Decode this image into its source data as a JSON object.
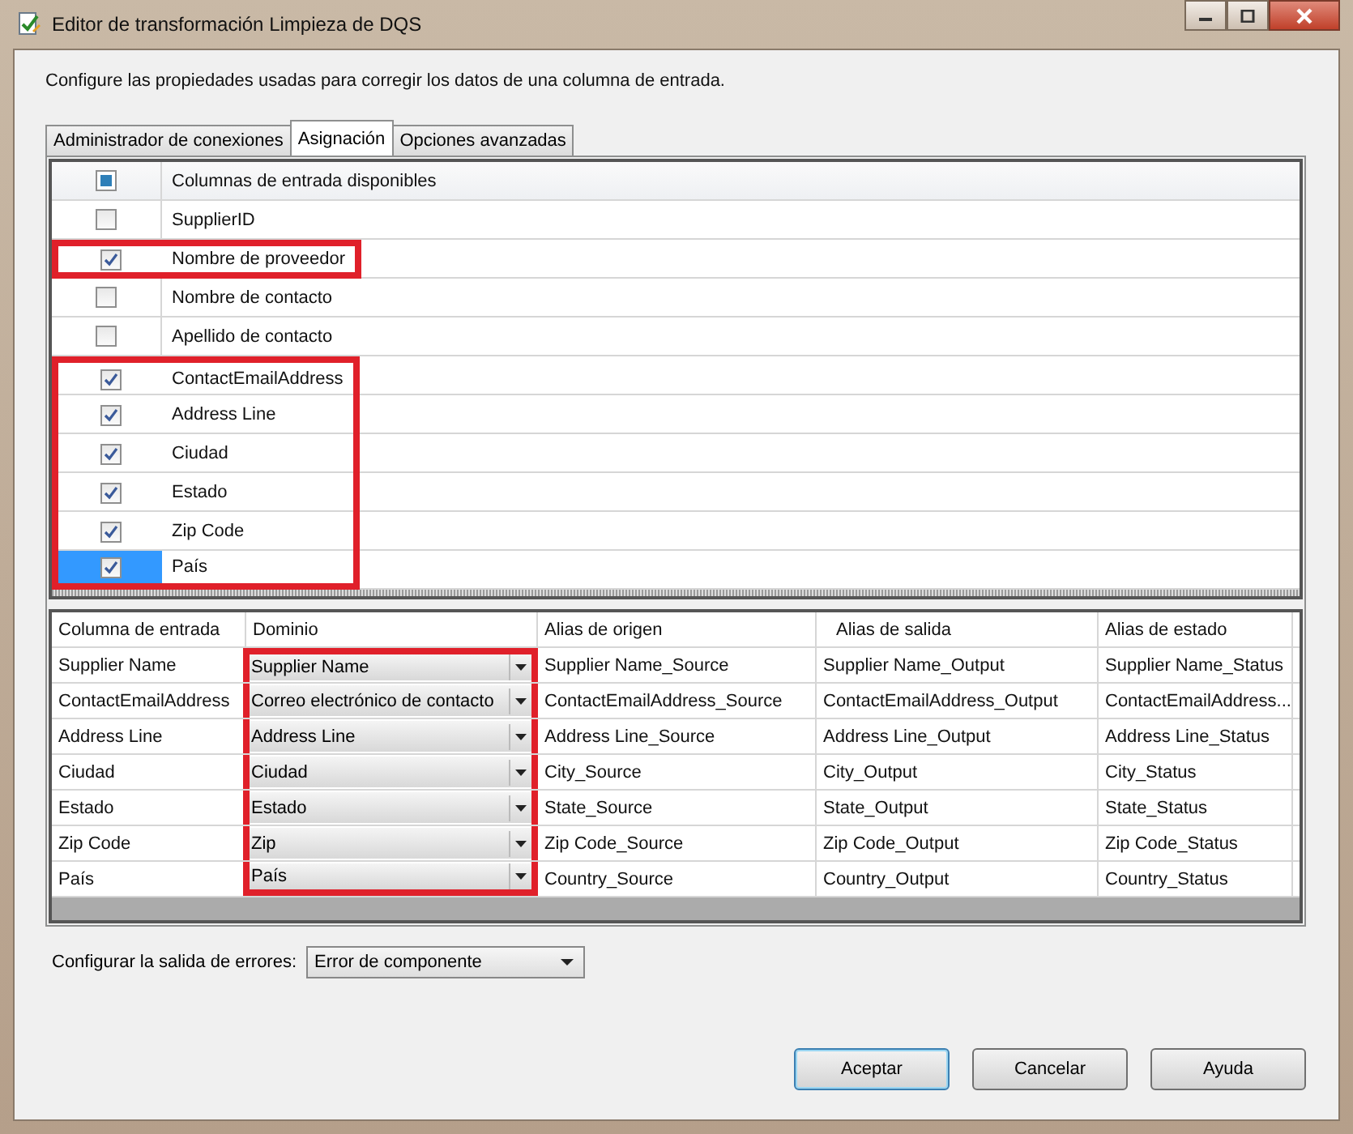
{
  "window": {
    "title": "Editor de transformación Limpieza de DQS"
  },
  "description": "Configure las propiedades usadas para corregir los datos de una columna de entrada.",
  "tabs": [
    {
      "label": "Administrador de conexiones",
      "selected": false
    },
    {
      "label": "Asignación",
      "selected": true
    },
    {
      "label": "Opciones avanzadas",
      "selected": false
    }
  ],
  "input_columns": {
    "header": "Columnas de entrada disponibles",
    "header_partial": true,
    "rows": [
      {
        "name": "SupplierID",
        "checked": false,
        "selected": false,
        "highlighted": false
      },
      {
        "name": "Nombre de proveedor",
        "checked": true,
        "selected": false,
        "highlighted": true
      },
      {
        "name": "Nombre de contacto",
        "checked": false,
        "selected": false,
        "highlighted": false
      },
      {
        "name": "Apellido de contacto",
        "checked": false,
        "selected": false,
        "highlighted": false
      },
      {
        "name": "ContactEmailAddress",
        "checked": true,
        "selected": false,
        "highlighted": true
      },
      {
        "name": "Address Line",
        "checked": true,
        "selected": false,
        "highlighted": true
      },
      {
        "name": "Ciudad",
        "checked": true,
        "selected": false,
        "highlighted": true
      },
      {
        "name": "Estado",
        "checked": true,
        "selected": false,
        "highlighted": true
      },
      {
        "name": "Zip Code",
        "checked": true,
        "selected": false,
        "highlighted": true
      },
      {
        "name": "País",
        "checked": true,
        "selected": true,
        "highlighted": true
      }
    ]
  },
  "mapping": {
    "columns": [
      "Columna de entrada",
      "Dominio",
      "Alias de origen",
      "Alias de salida",
      "Alias de estado"
    ],
    "domain_highlighted": true,
    "rows": [
      {
        "input": "Supplier Name",
        "domain": "Supplier Name",
        "source": "Supplier Name_Source",
        "output": "Supplier Name_Output",
        "status": "Supplier Name_Status"
      },
      {
        "input": "ContactEmailAddress",
        "domain": "Correo electrónico de contacto",
        "source": "ContactEmailAddress_Source",
        "output": "ContactEmailAddress_Output",
        "status": "ContactEmailAddress..."
      },
      {
        "input": "Address Line",
        "domain": "Address Line",
        "source": "Address Line_Source",
        "output": "Address Line_Output",
        "status": "Address Line_Status"
      },
      {
        "input": "Ciudad",
        "domain": "Ciudad",
        "source": "City_Source",
        "output": "City_Output",
        "status": "City_Status"
      },
      {
        "input": "Estado",
        "domain": "Estado",
        "source": "State_Source",
        "output": "State_Output",
        "status": "State_Status"
      },
      {
        "input": "Zip Code",
        "domain": "Zip",
        "source": "Zip Code_Source",
        "output": "Zip Code_Output",
        "status": "Zip Code_Status"
      },
      {
        "input": "País",
        "domain": "País",
        "source": "Country_Source",
        "output": "Country_Output",
        "status": "Country_Status"
      }
    ]
  },
  "error_output": {
    "label": "Configurar la salida de errores:",
    "value": "Error de componente"
  },
  "buttons": [
    "Aceptar",
    "Cancelar",
    "Ayuda"
  ]
}
